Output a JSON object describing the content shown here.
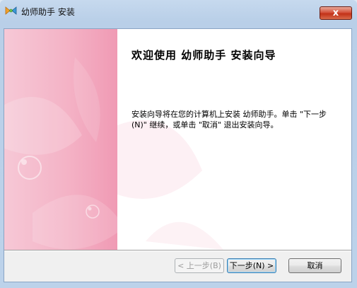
{
  "window": {
    "title": "幼师助手 安装",
    "close_label": "x"
  },
  "wizard": {
    "heading": "欢迎使用 幼师助手 安装向导",
    "description": "安装向导将在您的计算机上安装 幼师助手。单击 \"下一步(N)\" 继续，或单击 \"取消\" 退出安装向导。"
  },
  "buttons": {
    "back_label": "< 上一步(B)",
    "next_label": "下一步(N) >",
    "cancel_label": "取消"
  },
  "colors": {
    "side_panel": "#f4b3c6",
    "title_bar": "#c6d9ee",
    "close_button": "#c23118"
  },
  "icons": {
    "app": "installer-bow-icon",
    "close": "close-icon"
  }
}
